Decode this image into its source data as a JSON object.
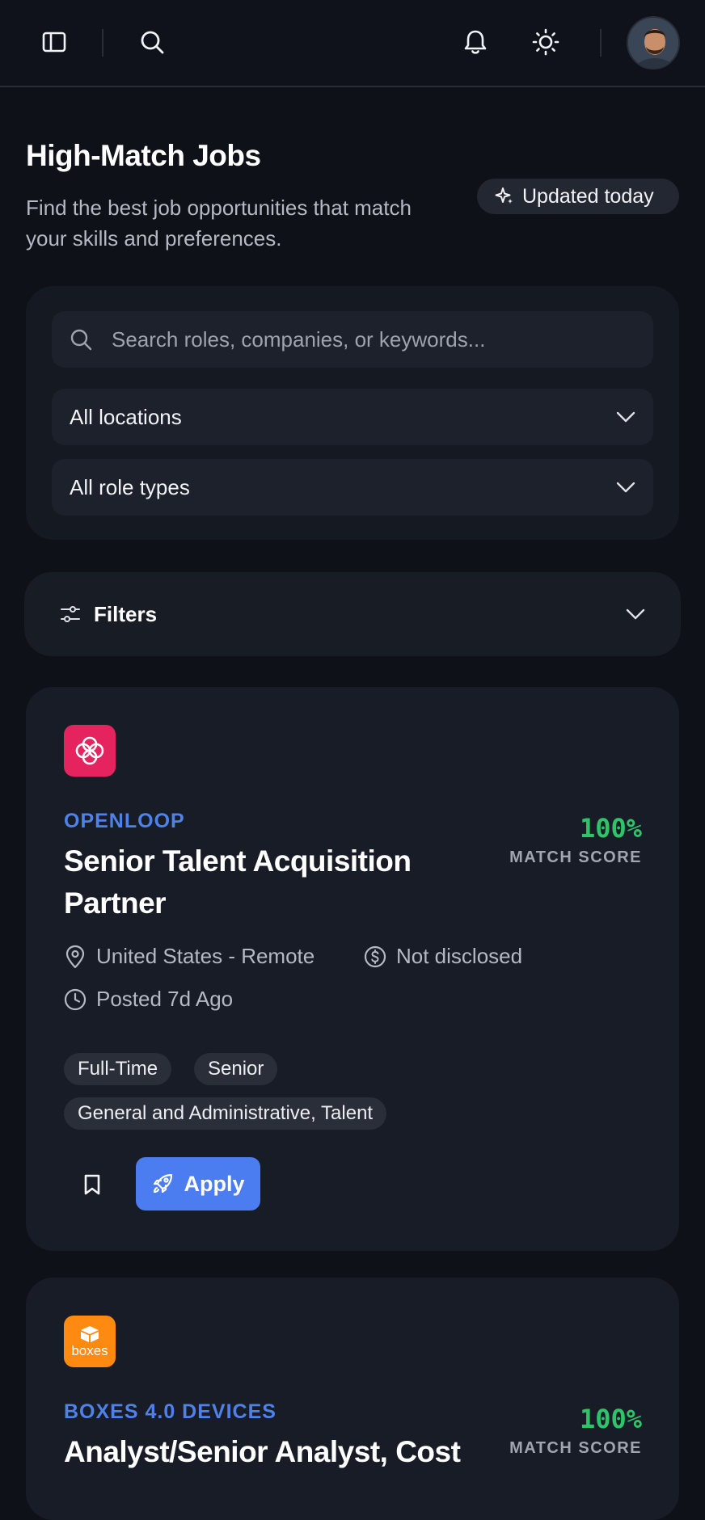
{
  "header": {
    "icons": [
      "sidebar-toggle-icon",
      "search-icon",
      "bell-icon",
      "sun-icon"
    ]
  },
  "page": {
    "title": "High-Match Jobs",
    "subtitle": "Find the best job opportunities that match your skills and preferences.",
    "updated_label": "Updated today"
  },
  "search": {
    "placeholder": "Search roles, companies, or keywords...",
    "value": "",
    "location_select": "All locations",
    "role_type_select": "All role types"
  },
  "filters": {
    "label": "Filters"
  },
  "jobs": [
    {
      "company": "OPENLOOP",
      "title": "Senior Talent Acquisition Partner",
      "match_score": "100%",
      "match_label": "MATCH SCORE",
      "location": "United States - Remote",
      "salary": "Not disclosed",
      "posted": "Posted 7d Ago",
      "tags": [
        "Full-Time",
        "Senior",
        "General and Administrative, Talent"
      ],
      "apply_label": "Apply",
      "logo_color": "#e5235e"
    },
    {
      "company": "BOXES 4.0 DEVICES",
      "title": "Analyst/Senior Analyst, Cost",
      "match_score": "100%",
      "match_label": "MATCH SCORE",
      "logo_text": "boxes",
      "logo_color": "#ff8a12"
    }
  ],
  "colors": {
    "background": "#0e1118",
    "card": "#181c26",
    "accent_blue": "#4b7cf0",
    "company_blue": "#4f82e8",
    "score_green": "#2fc36a"
  }
}
